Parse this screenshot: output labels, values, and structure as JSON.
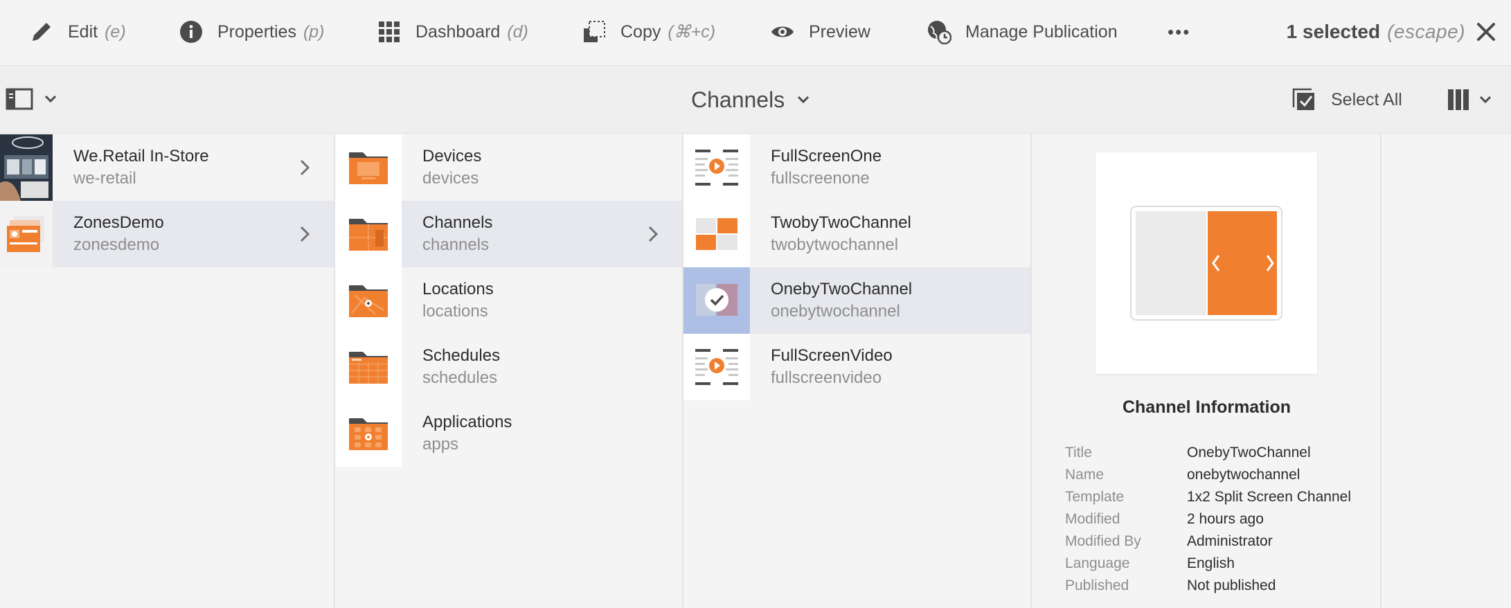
{
  "actions": {
    "edit": {
      "label": "Edit",
      "shortcut": "(e)"
    },
    "properties": {
      "label": "Properties",
      "shortcut": "(p)"
    },
    "dashboard": {
      "label": "Dashboard",
      "shortcut": "(d)"
    },
    "copy": {
      "label": "Copy",
      "shortcut": "(⌘+c)"
    },
    "preview": {
      "label": "Preview"
    },
    "manage_publication": {
      "label": "Manage Publication"
    },
    "more": "•••",
    "selection": {
      "count": "1 selected",
      "hint": "(escape)"
    }
  },
  "titlebar": {
    "title": "Channels",
    "select_all": "Select All"
  },
  "columns": {
    "projects": [
      {
        "title": "We.Retail In-Store",
        "name": "we-retail",
        "has_children": true,
        "active": false
      },
      {
        "title": "ZonesDemo",
        "name": "zonesdemo",
        "has_children": true,
        "active": true
      }
    ],
    "folders": [
      {
        "title": "Devices",
        "name": "devices",
        "active": false
      },
      {
        "title": "Channels",
        "name": "channels",
        "active": true
      },
      {
        "title": "Locations",
        "name": "locations",
        "active": false
      },
      {
        "title": "Schedules",
        "name": "schedules",
        "active": false
      },
      {
        "title": "Applications",
        "name": "apps",
        "active": false
      }
    ],
    "channels": [
      {
        "title": "FullScreenOne",
        "name": "fullscreenone",
        "selected": false
      },
      {
        "title": "TwobyTwoChannel",
        "name": "twobytwochannel",
        "selected": false
      },
      {
        "title": "OnebyTwoChannel",
        "name": "onebytwochannel",
        "selected": true
      },
      {
        "title": "FullScreenVideo",
        "name": "fullscreenvideo",
        "selected": false
      }
    ]
  },
  "info": {
    "heading": "Channel Information",
    "rows": [
      {
        "label": "Title",
        "value": "OnebyTwoChannel"
      },
      {
        "label": "Name",
        "value": "onebytwochannel"
      },
      {
        "label": "Template",
        "value": "1x2 Split Screen Channel"
      },
      {
        "label": "Modified",
        "value": "2 hours ago"
      },
      {
        "label": "Modified By",
        "value": "Administrator"
      },
      {
        "label": "Language",
        "value": "English"
      },
      {
        "label": "Published",
        "value": "Not published"
      }
    ]
  },
  "colors": {
    "accent_orange": "#f08030",
    "selection_blue": "#aebfe6",
    "icon_gray": "#4b4b4b"
  }
}
